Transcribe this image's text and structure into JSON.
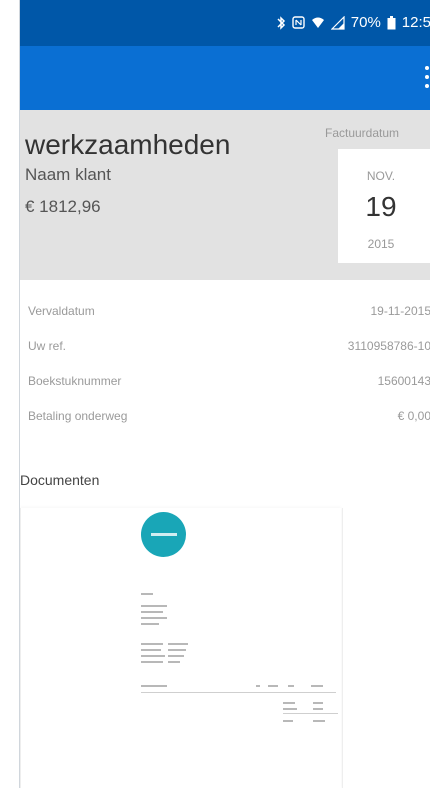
{
  "status_bar": {
    "battery_percent": "70%",
    "time": "12:5",
    "icons": [
      "bluetooth-icon",
      "nfc-icon",
      "wifi-icon",
      "signal-icon",
      "battery-icon"
    ]
  },
  "app_bar": {
    "menu_icon": "more-vertical-icon"
  },
  "invoice": {
    "title": "werkzaamheden",
    "client": "Naam klant",
    "amount": "€ 1812,96",
    "date_label": "Factuurdatum",
    "date_month": "NOV.",
    "date_day": "19",
    "date_year": "2015"
  },
  "details": [
    {
      "label": "Vervaldatum",
      "value": "19-11-2015"
    },
    {
      "label": "Uw ref.",
      "value": "3110958786-10"
    },
    {
      "label": "Boekstuknummer",
      "value": "15600143"
    },
    {
      "label": "Betaling onderweg",
      "value": "€ 0,00"
    }
  ],
  "documents": {
    "title": "Documenten"
  },
  "colors": {
    "status_bar": "#0057a8",
    "app_bar": "#0a6fd3",
    "header_bg": "#e2e2e2",
    "logo": "#19a6b7"
  }
}
